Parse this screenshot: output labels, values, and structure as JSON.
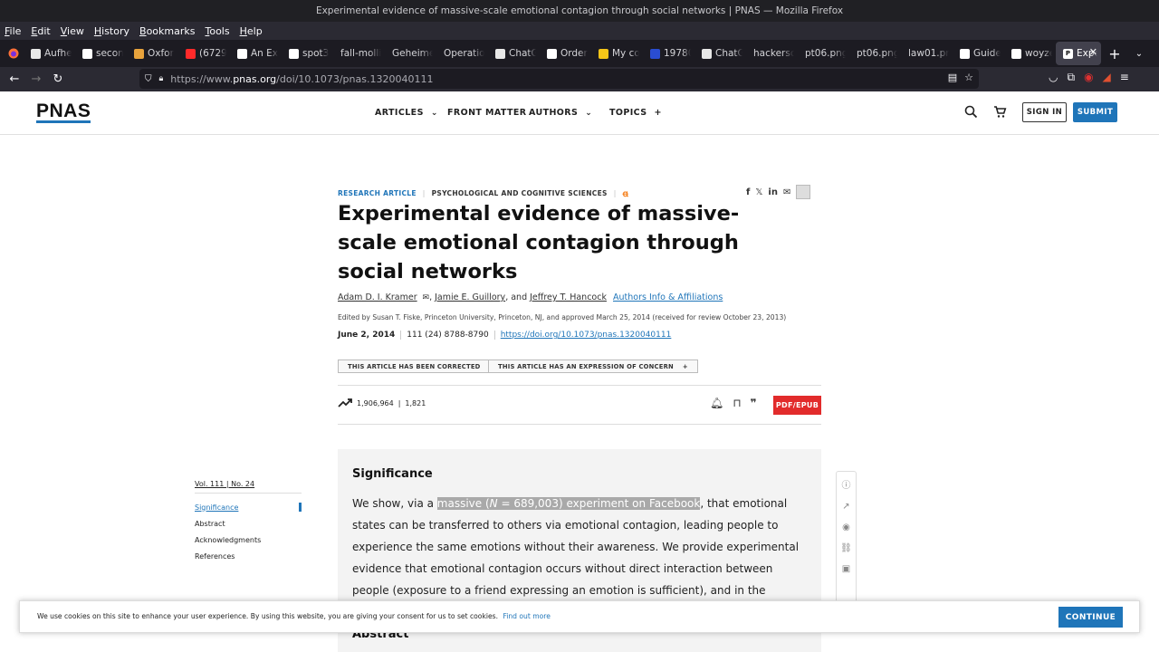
{
  "window": {
    "title": "Experimental evidence of massive-scale emotional contagion through social networks | PNAS — Mozilla Firefox"
  },
  "menu": [
    "File",
    "Edit",
    "View",
    "History",
    "Bookmarks",
    "Tools",
    "Help"
  ],
  "tabs": [
    {
      "label": "Aufhe",
      "icon": "chatgpt-icon",
      "color": "#e8e8e8"
    },
    {
      "label": "secon",
      "icon": "google-icon",
      "color": "#ffffff"
    },
    {
      "label": "Oxfor",
      "icon": "oxford-icon",
      "color": "#e8a33c"
    },
    {
      "label": "(6729",
      "icon": "youtube-icon",
      "color": "#ff2a2a"
    },
    {
      "label": "An Ex",
      "icon": "wikipedia-icon",
      "color": "#ffffff"
    },
    {
      "label": "spot3",
      "icon": "google-icon",
      "color": "#ffffff"
    },
    {
      "label": "fall-molli",
      "icon": "none",
      "color": "transparent"
    },
    {
      "label": "Geheime",
      "icon": "none",
      "color": "transparent"
    },
    {
      "label": "Operation",
      "icon": "none",
      "color": "transparent"
    },
    {
      "label": "ChatG",
      "icon": "chatgpt-icon",
      "color": "#e8e8e8"
    },
    {
      "label": "Order",
      "icon": "star-icon",
      "color": "#ffffff"
    },
    {
      "label": "My co",
      "icon": "notes-icon",
      "color": "#f5c518"
    },
    {
      "label": "19780",
      "icon": "nasa-icon",
      "color": "#2a4dd1"
    },
    {
      "label": "ChatG",
      "icon": "chatgpt-icon",
      "color": "#e8e8e8"
    },
    {
      "label": "hackersc",
      "icon": "none",
      "color": "transparent"
    },
    {
      "label": "pt06.png",
      "icon": "none",
      "color": "transparent"
    },
    {
      "label": "pt06.png",
      "icon": "none",
      "color": "transparent"
    },
    {
      "label": "law01.pn",
      "icon": "none",
      "color": "transparent"
    },
    {
      "label": "Guide",
      "icon": "guide-icon",
      "color": "#ffffff"
    },
    {
      "label": "woyze",
      "icon": "google-icon",
      "color": "#ffffff"
    }
  ],
  "active_tab": {
    "label": "Expe",
    "icon": "pnas-icon"
  },
  "address": {
    "prefix": "https://www.",
    "host": "pnas.org",
    "path": "/doi/10.1073/pnas.1320040111"
  },
  "site": {
    "logo": "PNAS",
    "nav": {
      "articles": "ARTICLES",
      "front_matter": "FRONT MATTER",
      "authors": "AUTHORS",
      "topics": "TOPICS"
    },
    "sign_in": "SIGN IN",
    "submit": "SUBMIT"
  },
  "article": {
    "type": "RESEARCH ARTICLE",
    "section": "PSYCHOLOGICAL AND COGNITIVE SCIENCES",
    "title": "Experimental evidence of massive-scale emotional contagion through social networks",
    "author1": "Adam D. I. Kramer",
    "author2": "Jamie E. Guillory",
    "and": ", and ",
    "author3": "Jeffrey T. Hancock",
    "affiliations": "Authors Info & Affiliations",
    "edited": "Edited by Susan T. Fiske, Princeton University, Princeton, NJ, and approved March 25, 2014 (received for review October 23, 2013)",
    "date": "June 2, 2014",
    "volume": "111 (24) 8788-8790",
    "doi": "https://doi.org/10.1073/pnas.1320040111",
    "notice1": "THIS ARTICLE HAS BEEN CORRECTED",
    "notice2": "THIS ARTICLE HAS AN EXPRESSION OF CONCERN",
    "views": "1,906,964",
    "citations": "1,821",
    "pdf": "PDF/EPUB"
  },
  "toc": {
    "volume": "Vol. 111 | No. 24",
    "items": [
      "Significance",
      "Abstract",
      "Acknowledgments",
      "References"
    ]
  },
  "significance": {
    "heading": "Significance",
    "pre": "We show, via a ",
    "hl1": "massive (",
    "n": "N",
    "hl2": " = 689,003) experiment on Facebook",
    "post": ", that emotional states can be transferred to others via emotional contagion, leading people to experience the same emotions without their awareness. We provide experimental evidence that emotional contagion occurs without direct interaction between people (exposure to a friend expressing an emotion is sufficient), and in the complete absence of nonverbal cues."
  },
  "abstract": {
    "heading": "Abstract"
  },
  "cookie": {
    "text": "We use cookies on this site to enhance your user experience. By using this website, you are giving your consent for us to set cookies.",
    "link": "Find out more",
    "button": "CONTINUE"
  },
  "colors": {
    "accent": "#1f75b9",
    "pdf": "#e22b2b",
    "highlight": "#a9a9a9"
  }
}
